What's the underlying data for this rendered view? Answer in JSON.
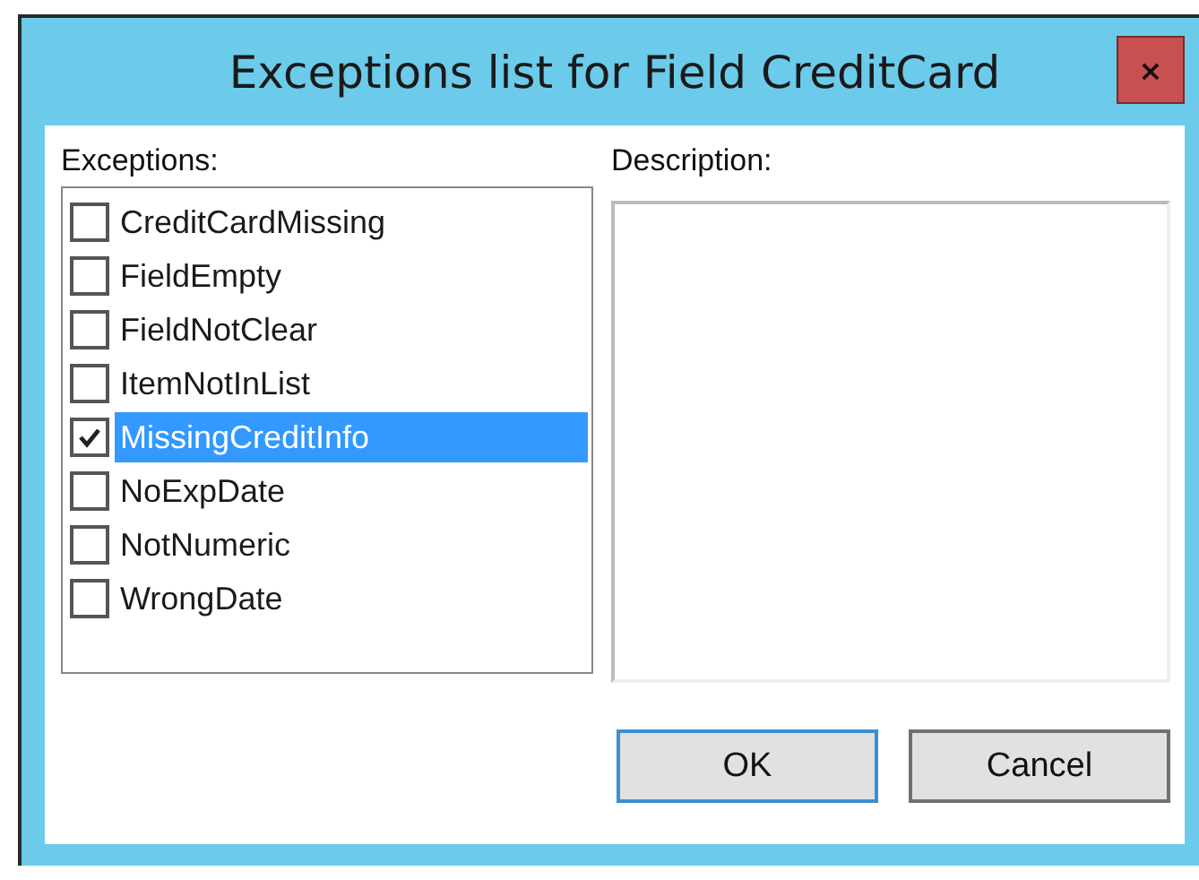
{
  "window": {
    "title": "Exceptions list for Field CreditCard",
    "close_label": "×"
  },
  "exceptions": {
    "label": "Exceptions:",
    "items": [
      {
        "label": "CreditCardMissing",
        "checked": false,
        "selected": false
      },
      {
        "label": "FieldEmpty",
        "checked": false,
        "selected": false
      },
      {
        "label": "FieldNotClear",
        "checked": false,
        "selected": false
      },
      {
        "label": "ItemNotInList",
        "checked": false,
        "selected": false
      },
      {
        "label": "MissingCreditInfo",
        "checked": true,
        "selected": true
      },
      {
        "label": "NoExpDate",
        "checked": false,
        "selected": false
      },
      {
        "label": "NotNumeric",
        "checked": false,
        "selected": false
      },
      {
        "label": "WrongDate",
        "checked": false,
        "selected": false
      }
    ]
  },
  "description": {
    "label": "Description:"
  },
  "buttons": [
    {
      "label": "OK",
      "default": true
    },
    {
      "label": "Cancel",
      "default": false
    }
  ]
}
